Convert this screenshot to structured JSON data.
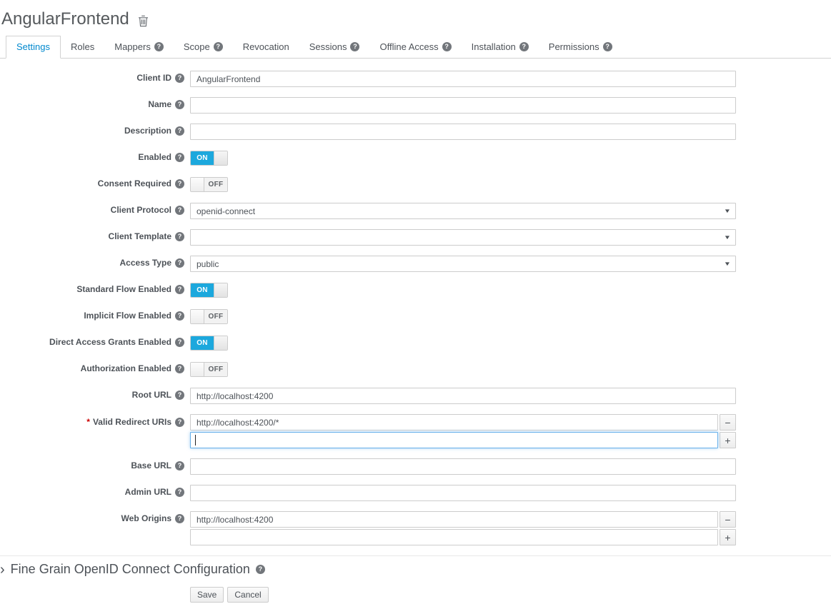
{
  "header": {
    "title": "AngularFrontend"
  },
  "tabs": [
    {
      "label": "Settings",
      "active": true,
      "help": false
    },
    {
      "label": "Roles",
      "active": false,
      "help": false
    },
    {
      "label": "Mappers",
      "active": false,
      "help": true
    },
    {
      "label": "Scope",
      "active": false,
      "help": true
    },
    {
      "label": "Revocation",
      "active": false,
      "help": false
    },
    {
      "label": "Sessions",
      "active": false,
      "help": true
    },
    {
      "label": "Offline Access",
      "active": false,
      "help": true
    },
    {
      "label": "Installation",
      "active": false,
      "help": true
    },
    {
      "label": "Permissions",
      "active": false,
      "help": true
    }
  ],
  "form": {
    "required_marker": "*",
    "help_glyph": "?",
    "caret_glyph": "▼",
    "minus_glyph": "−",
    "plus_glyph": "+",
    "fields": {
      "client_id": {
        "label": "Client ID",
        "value": "AngularFrontend"
      },
      "name": {
        "label": "Name",
        "value": ""
      },
      "description": {
        "label": "Description",
        "value": ""
      },
      "enabled": {
        "label": "Enabled",
        "state": "ON"
      },
      "consent_required": {
        "label": "Consent Required",
        "state": "OFF"
      },
      "client_protocol": {
        "label": "Client Protocol",
        "value": "openid-connect"
      },
      "client_template": {
        "label": "Client Template",
        "value": ""
      },
      "access_type": {
        "label": "Access Type",
        "value": "public"
      },
      "standard_flow": {
        "label": "Standard Flow Enabled",
        "state": "ON"
      },
      "implicit_flow": {
        "label": "Implicit Flow Enabled",
        "state": "OFF"
      },
      "direct_access_grants": {
        "label": "Direct Access Grants Enabled",
        "state": "ON"
      },
      "authorization_enabled": {
        "label": "Authorization Enabled",
        "state": "OFF"
      },
      "root_url": {
        "label": "Root URL",
        "value": "http://localhost:4200"
      },
      "redirect_uris": {
        "label": "Valid Redirect URIs",
        "required": true,
        "values": {
          "0": "http://localhost:4200/*",
          "1": ""
        }
      },
      "base_url": {
        "label": "Base URL",
        "value": ""
      },
      "admin_url": {
        "label": "Admin URL",
        "value": ""
      },
      "web_origins": {
        "label": "Web Origins",
        "values": {
          "0": "http://localhost:4200",
          "1": ""
        }
      }
    }
  },
  "section": {
    "chevron": "›",
    "fine_grain_title": "Fine Grain OpenID Connect Configuration"
  },
  "actions": {
    "save": "Save",
    "cancel": "Cancel"
  },
  "colors": {
    "toggle_on_blue": "#1ca8dd",
    "tab_active_blue": "#0088ce",
    "required_red": "#cc0000",
    "border_gray": "#cccccc",
    "text_gray": "#4d5258"
  }
}
